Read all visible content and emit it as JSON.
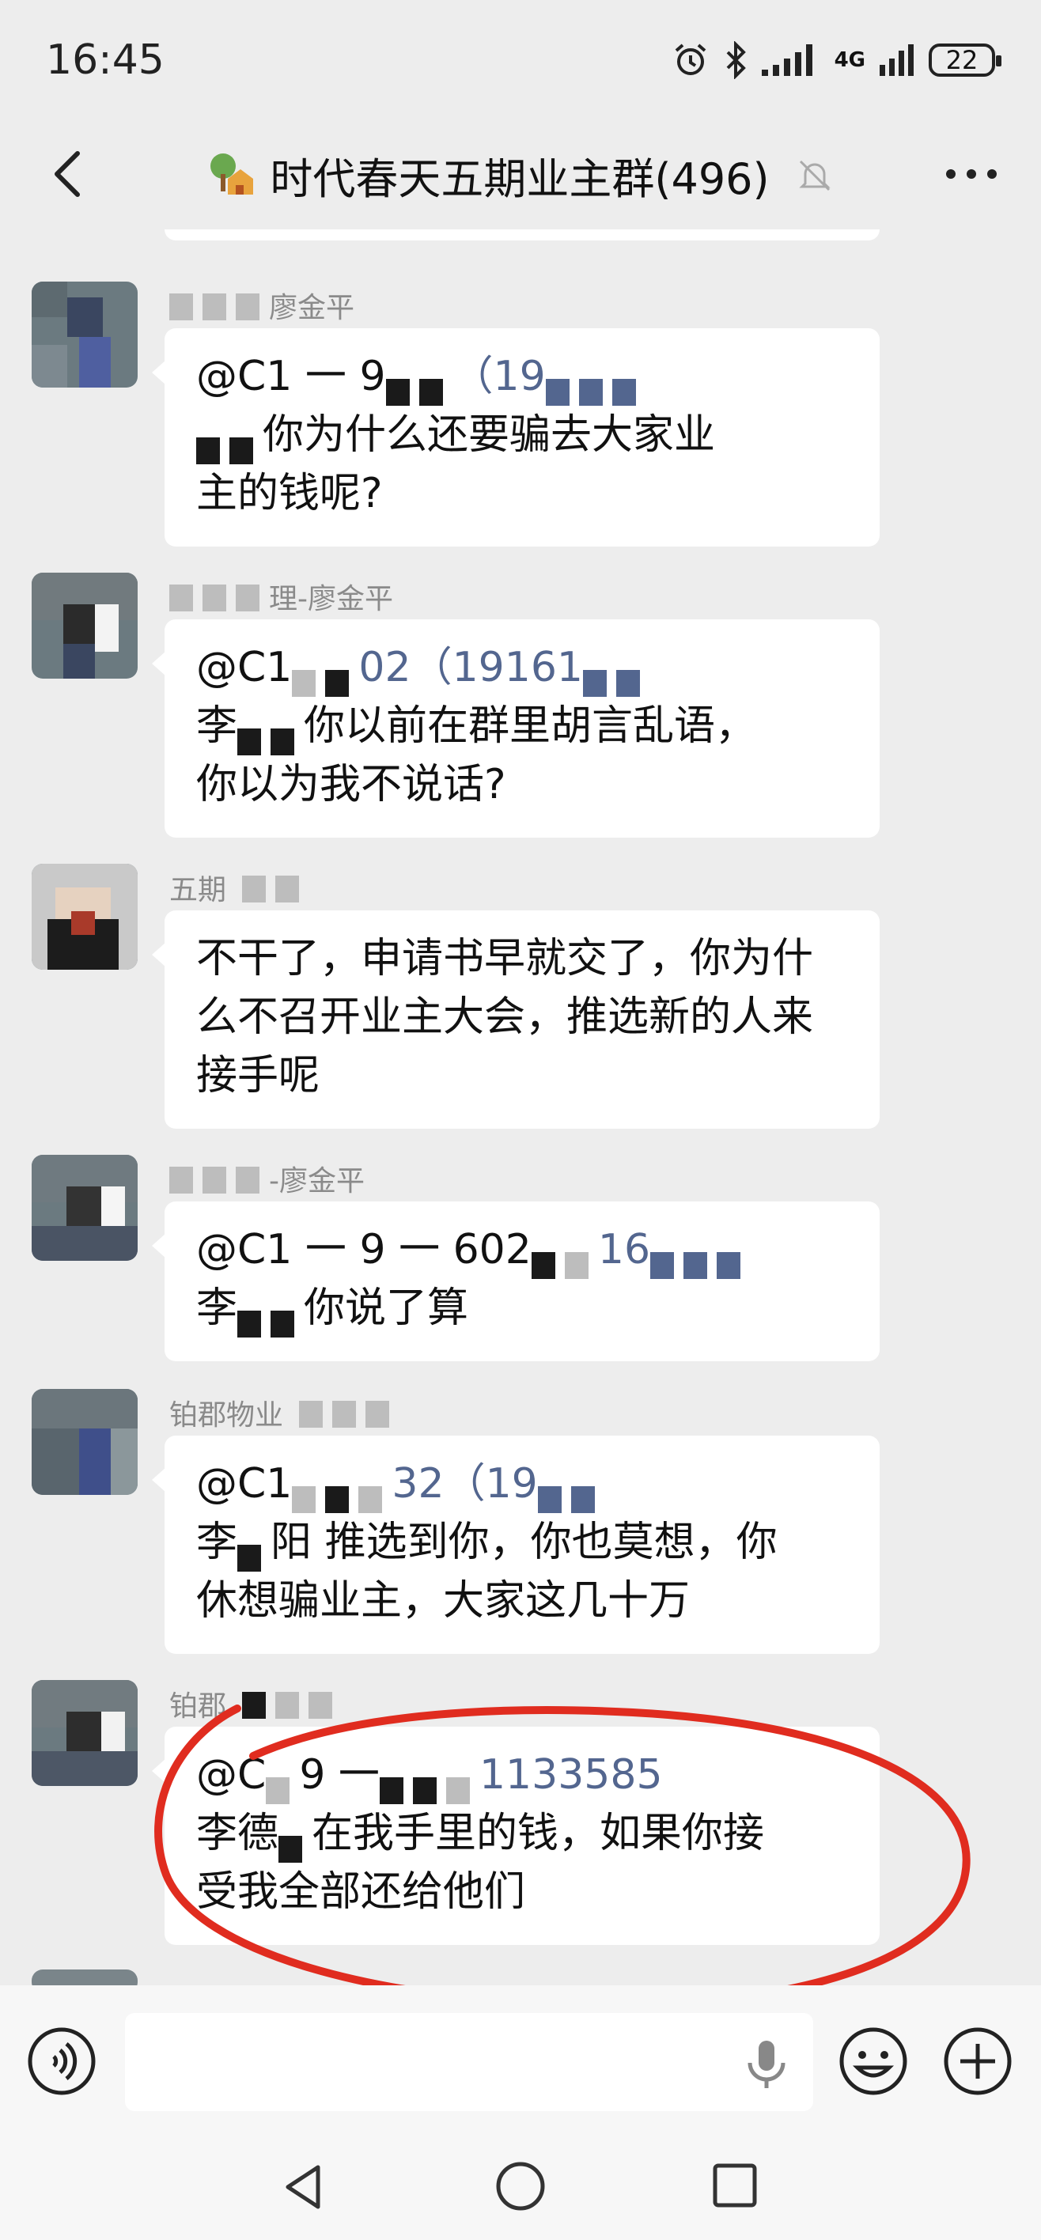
{
  "status": {
    "time": "16:45",
    "network": "4G",
    "battery": "22"
  },
  "header": {
    "title": "时代春天五期业主群(496)",
    "title_icon": "house-tree-icon"
  },
  "messages": [
    {
      "sender": "廖金平",
      "line1": "@C1 一 9",
      "line1_tail": "（19",
      "line2": "你为什么还要骗去大家业",
      "line3": "主的钱呢?"
    },
    {
      "sender": "理-廖金平",
      "line1": "@C1",
      "line1_tail": "02（19161",
      "line2_prefix": "李",
      "line2": "你以前在群里胡言乱语，",
      "line3": "你以为我不说话?"
    },
    {
      "sender": "五期",
      "line1": "不干了，申请书早就交了，你为什",
      "line2": "么不召开业主大会，推选新的人来",
      "line3": "接手呢"
    },
    {
      "sender": "-廖金平",
      "line1": "@C1 一 9 一 602",
      "line1_tail": "16",
      "line2_prefix": "李",
      "line2": "你说了算"
    },
    {
      "sender": "铂郡物业",
      "line1": "@C1",
      "line1_tail": "32（19",
      "line2_prefix": "李",
      "line2_mid": "阳",
      "line2": "推选到你，你也莫想，你",
      "line3": "休想骗业主，大家这几十万"
    },
    {
      "sender": "铂郡",
      "line1": "@C",
      "line1_mid": "9 一",
      "line1_tail": "1133585",
      "line2_prefix": "李德",
      "line2": "在我手里的钱，如果你接",
      "line3": "受我全部还给他们"
    }
  ]
}
